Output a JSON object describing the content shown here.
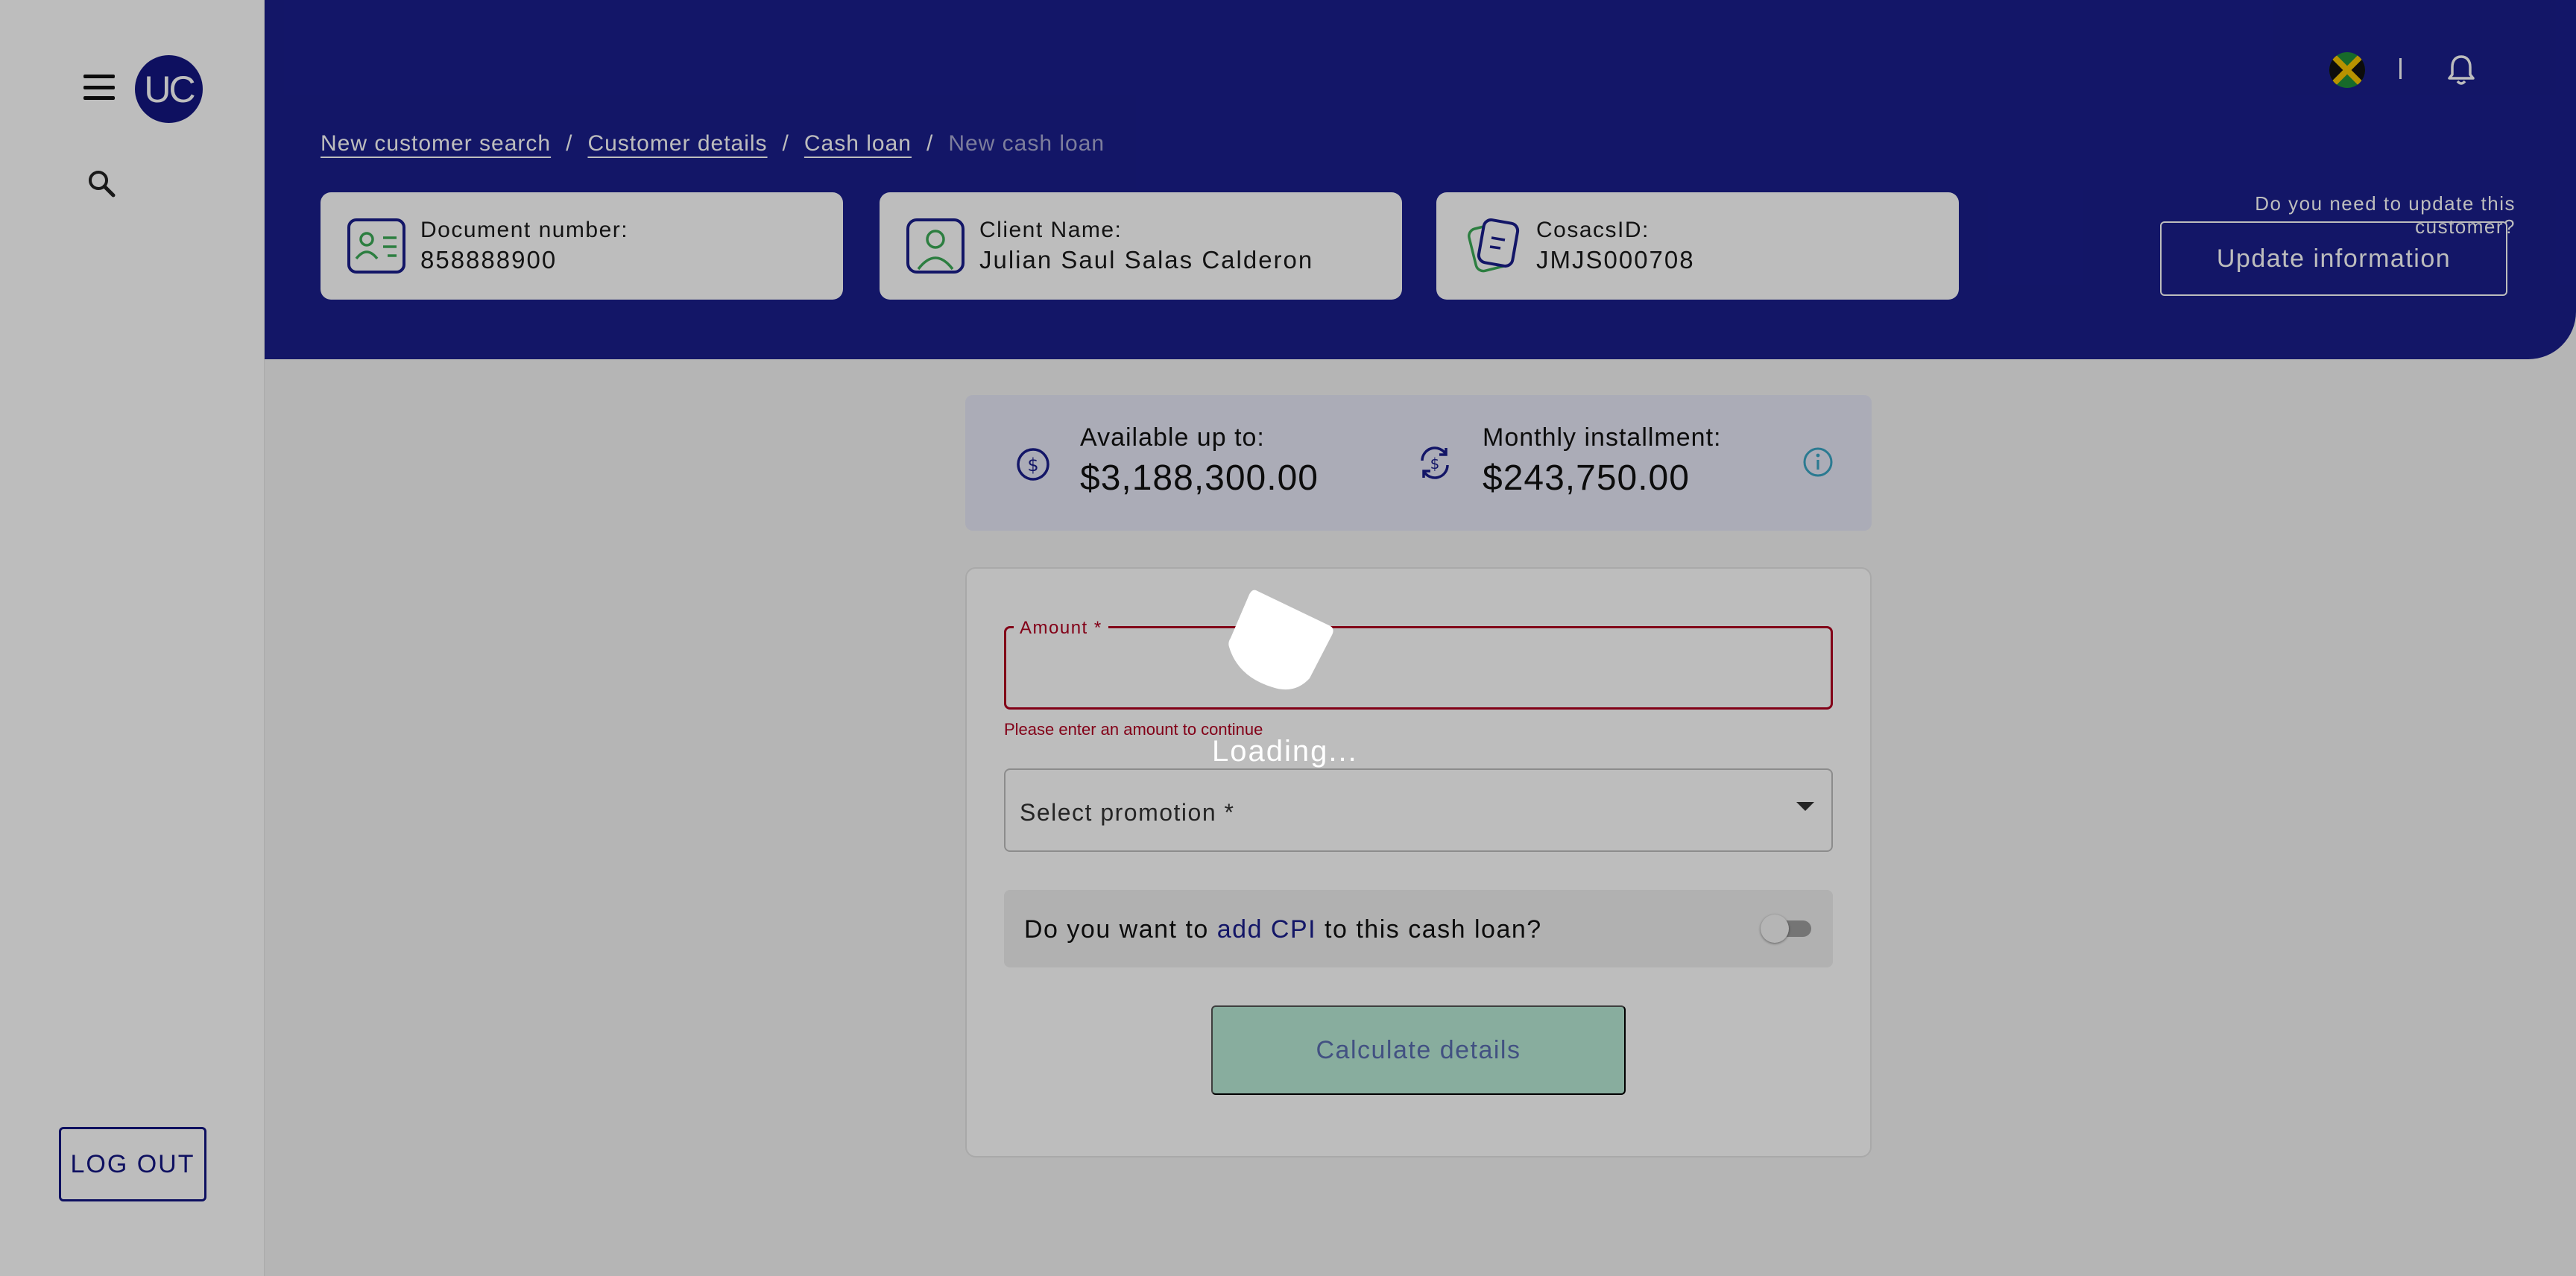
{
  "sidebar": {
    "menu_icon": "menu-icon",
    "avatar_initials": "UC",
    "search_icon": "search-icon",
    "logout_label": "LOG OUT"
  },
  "header": {
    "flag_icon": "jamaica-flag-icon",
    "notifications_icon": "bell-icon",
    "breadcrumb": {
      "items": [
        "New customer search",
        "Customer details",
        "Cash loan"
      ],
      "current": "New cash loan"
    },
    "cards": [
      {
        "label": "Document number:",
        "value": "858888900",
        "icon": "id-card-icon"
      },
      {
        "label": "Client Name:",
        "value": "Julian Saul Salas Calderon",
        "icon": "user-icon"
      },
      {
        "label": "CosacsID:",
        "value": "JMJS000708",
        "icon": "documents-icon"
      }
    ],
    "update_question": "Do you need to update this customer?",
    "update_button": "Update information"
  },
  "summary": {
    "available_label": "Available up to:",
    "available_value": "$3,188,300.00",
    "available_icon": "dollar-circle-icon",
    "installment_label": "Monthly installment:",
    "installment_value": "$243,750.00",
    "installment_icon": "refresh-dollar-icon",
    "info_icon": "info-icon"
  },
  "form": {
    "amount_label": "Amount *",
    "amount_value": "",
    "amount_error": "Please enter an amount to continue",
    "promotion_placeholder": "Select promotion *",
    "cpi_prefix": "Do you want to ",
    "cpi_link": "add CPI",
    "cpi_suffix": " to this cash loan?",
    "cpi_toggle_on": false,
    "calculate_button": "Calculate details"
  },
  "overlay": {
    "loading_text": "Loading..."
  },
  "colors": {
    "brand_navy": "#1a1e8c",
    "error_red": "#b00020",
    "accent_green": "#3caa57",
    "info_teal": "#3aa5c4",
    "disabled_button": "#b8ead5"
  }
}
